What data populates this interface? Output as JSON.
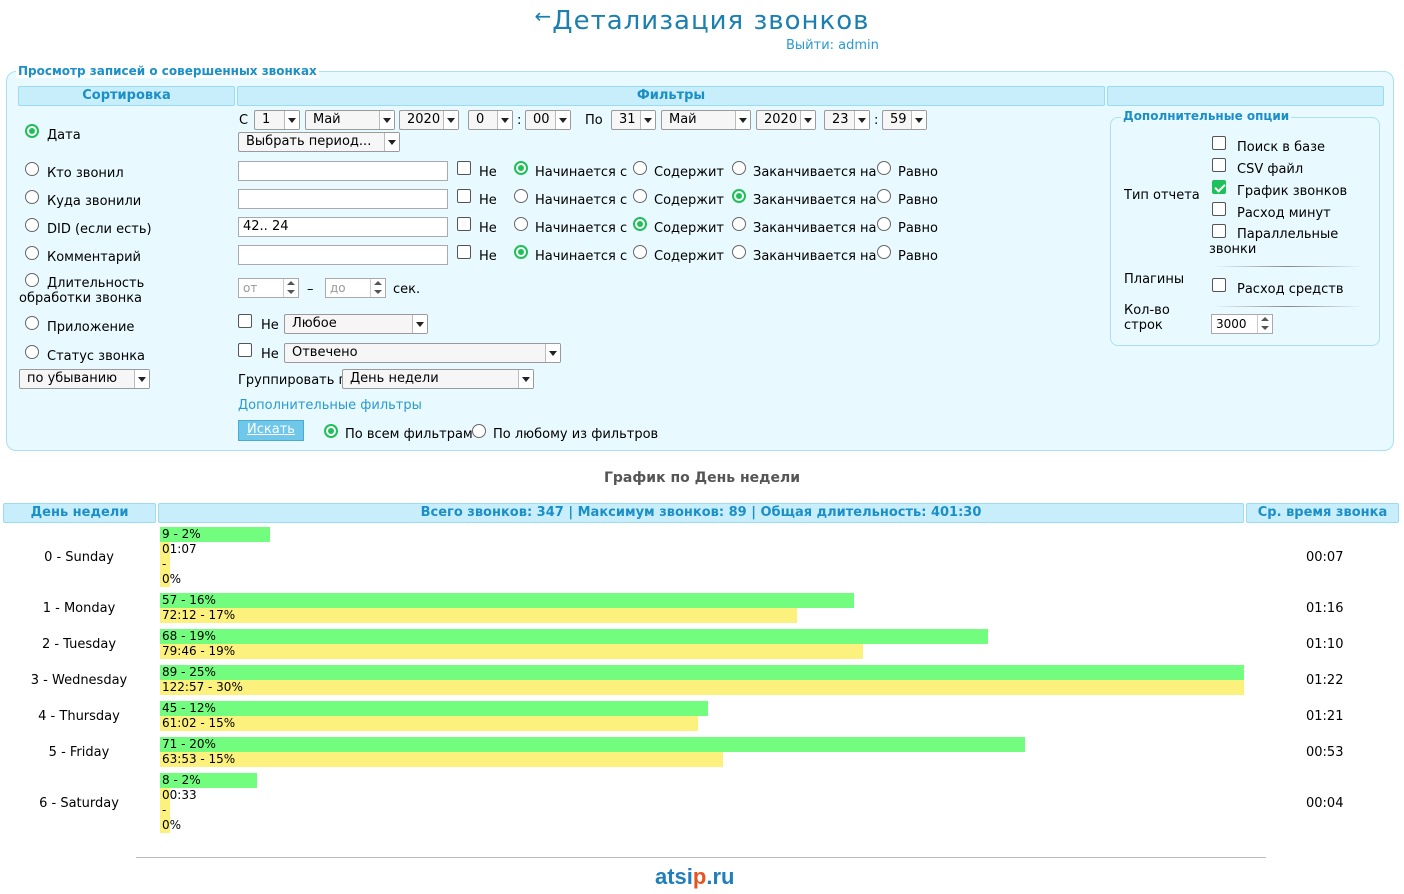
{
  "header": {
    "back_arrow": "←",
    "title": "Детализация звонков",
    "logout": "Выйти: admin"
  },
  "form": {
    "legend": "Просмотр записей о совершенных звонках",
    "col_sort": "Сортировка",
    "col_filters": "Фильтры",
    "sort_options": [
      "Дата",
      "Кто звонил",
      "Куда звонили",
      "DID (если есть)",
      "Комментарий",
      "Длительность обработки звонка",
      "Приложение",
      "Статус звонка"
    ],
    "sort_selected": 0,
    "order": "по убыванию",
    "date": {
      "from_label": "С",
      "from_day": "1",
      "from_month": "Май",
      "from_year": "2020",
      "from_hour": "0",
      "from_min": "00",
      "to_label": "По",
      "to_day": "31",
      "to_month": "Май",
      "to_year": "2020",
      "to_hour": "23",
      "to_min": "59",
      "colon": ":",
      "period_select": "Выбрать период..."
    },
    "match_labels": {
      "not": "Не",
      "starts": "Начинается с",
      "contains": "Содержит",
      "ends": "Заканчивается на",
      "equals": "Равно"
    },
    "text_filters": [
      {
        "value": "",
        "selected": "starts"
      },
      {
        "value": "",
        "selected": "ends"
      },
      {
        "value": "42.. 24",
        "selected": "contains"
      },
      {
        "value": "",
        "selected": "starts"
      }
    ],
    "duration": {
      "from_placeholder": "от",
      "dash": "–",
      "to_placeholder": "до",
      "unit": "сек."
    },
    "app": {
      "not": "Не",
      "value": "Любое"
    },
    "status": {
      "not": "Не",
      "value": "Отвечено"
    },
    "group_by_label": "Группировать по",
    "group_by": "День недели",
    "more_filters": "Дополнительные фильтры",
    "search_button": "Искать",
    "match_all": "По всем фильтрам",
    "match_any": "По любому из фильтров"
  },
  "options": {
    "legend": "Дополнительные опции",
    "report_type_label": "Тип отчета",
    "report_types": [
      {
        "label": "Поиск в базе",
        "checked": false
      },
      {
        "label": "CSV файл",
        "checked": false
      },
      {
        "label": "График звонков",
        "checked": true
      },
      {
        "label": "Расход минут",
        "checked": false
      },
      {
        "label": "Параллельные звонки",
        "checked": false
      }
    ],
    "plugins_label": "Плагины",
    "plugin": {
      "label": "Расход средств",
      "checked": false
    },
    "rows_label": "Кол-во строк",
    "rows_value": "3000"
  },
  "chart": {
    "title": "График по День недели",
    "col_day": "День недели",
    "col_summary": "Всего звонков: 347 | Максимум звонков: 89 | Общая длительность: 401:30",
    "col_avg": "Ср. время звонка"
  },
  "chart_data": {
    "type": "bar",
    "categories": [
      "0 - Sunday",
      "1 - Monday",
      "2 - Tuesday",
      "3 - Wednesday",
      "4 - Thursday",
      "5 - Friday",
      "6 - Saturday"
    ],
    "series": [
      {
        "values": [
          9,
          57,
          68,
          89,
          45,
          71,
          8
        ],
        "labels": [
          "9 - 2%",
          "57 - 16%",
          "68 - 19%",
          "89 - 25%",
          "45 - 12%",
          "71 - 20%",
          "8 - 2%"
        ],
        "color": "#72fd7e"
      },
      {
        "values": [
          1.12,
          72.2,
          79.77,
          122.95,
          61.03,
          63.88,
          0.55
        ],
        "labels": [
          "01:07",
          "72:12 - 17%",
          "79:46 - 19%",
          "122:57 - 30%",
          "61:02 - 15%",
          "63:53 - 15%",
          "00:33"
        ],
        "color": "#fdf17e"
      }
    ],
    "small_extra": [
      "-",
      "0%"
    ],
    "avg_times": [
      "00:07",
      "01:16",
      "01:10",
      "01:22",
      "01:21",
      "00:53",
      "00:04"
    ]
  },
  "footer": {
    "logo_a": "atsi",
    "logo_b": "p",
    "logo_c": ".ru"
  }
}
